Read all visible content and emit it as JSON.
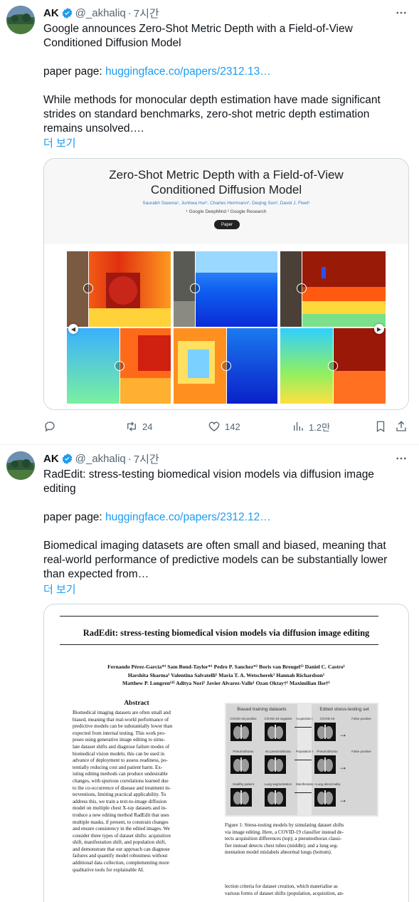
{
  "tweets": [
    {
      "author": {
        "name": "AK",
        "handle": "@_akhaliq",
        "time": "7시간"
      },
      "text_line1": "Google announces Zero-Shot Metric Depth with a Field-of-View",
      "text_line2": "Conditioned Diffusion Model",
      "paper_label": "paper page: ",
      "paper_link": "huggingface.co/papers/2312.13…",
      "body_line1": "While methods for monocular depth estimation have made significant",
      "body_line2": "strides on standard benchmarks, zero-shot metric depth estimation",
      "body_line3": "remains unsolved….",
      "show_more": "더 보기",
      "media": {
        "title_line1": "Zero-Shot Metric Depth with a Field-of-View",
        "title_line2": "Conditioned Diffusion Model",
        "authors": "Saurabh Saxena¹, Junhwa Hur², Charles Herrmann², Deqing Sun², David J. Fleet¹",
        "affiliations": "¹ Google DeepMind ² Google Research",
        "button": "Paper"
      },
      "stats": {
        "retweets": "24",
        "likes": "142",
        "views": "1.2만"
      }
    },
    {
      "author": {
        "name": "AK",
        "handle": "@_akhaliq",
        "time": "7시간"
      },
      "text_line1": "RadEdit: stress-testing biomedical vision models via diffusion image",
      "text_line2": "editing",
      "paper_label": "paper page: ",
      "paper_link": "huggingface.co/papers/2312.12…",
      "body_line1": "Biomedical imaging datasets are often small and biased, meaning that",
      "body_line2": "real-world performance of predictive models can be substantially lower",
      "body_line3": "than expected from…",
      "show_more": "더 보기",
      "media": {
        "title": "RadEdit: stress-testing biomedical vision models via diffusion image editing",
        "authors_line1": "Fernando Pérez-García*¹  Sam Bond-Taylor*¹  Pedro P. Sanchez*²  Boris van Breugel¹³  Daniel C. Castro¹",
        "authors_line2": "Harshita Sharma¹  Valentina Salvatelli¹  Maria T. A. Wetscherek¹  Hannah Richardson¹",
        "authors_line3": "Matthew P. Lungren¹⁴⁵  Aditya Nori¹  Javier Alvarez-Valle¹  Ozan Oktay†¹  Maximilian Ilse†¹",
        "abstract_heading": "Abstract",
        "abstract_lines": [
          "Biomedical imaging datasets are often small and",
          "biased, meaning that real-world performance of",
          "predictive models can be substantially lower than",
          "expected from internal testing.  This work pro-",
          "poses using generative image editing to simu-",
          "late dataset shifts and diagnose failure modes of",
          "biomedical vision models; this can be used in",
          "advance of deployment to assess readiness, po-",
          "tentially reducing cost and patient harm.  Ex-",
          "isting editing methods can produce undesirable",
          "changes, with spurious correlations learned due",
          "to the co-occurrence of disease and treatment in-",
          "terventions, limiting practical applicability.  To",
          "address this, we train a text-to-image diffusion",
          "model on multiple chest X-ray datasets and in-",
          "troduce a new editing method RadEdit that uses",
          "multiple masks, if present, to constrain changes",
          "and ensure consistency in the edited images. We",
          "consider three types of dataset shifts: acquisition",
          "shift, manifestation shift, and population shift,",
          "and demonstrate that our approach can diagnose",
          "failures and quantify model robustness without",
          "additional data collection, complementing more",
          "qualitative tools for explainable AI."
        ],
        "fig_left_title": "Biased training datasets",
        "fig_right_title": "Edited stress-testing set",
        "fig_row_labels": [
          [
            "COVID-19 positive",
            "COVID-19 negative",
            "Acquisition shift",
            "COVID-19",
            "False positive"
          ],
          [
            "Pneumothorax",
            "No pneumothorax",
            "Population shift",
            "Pneumothorax",
            "False positive"
          ],
          [
            "Healthy patient",
            "Lung segmentation",
            "Manifestation shift",
            "+Lung abnormality",
            ""
          ]
        ],
        "caption_lines": [
          "Figure 1: Stress-testing models by simulating dataset shifts",
          "via image editing.  Here, a COVID-19 classifier instead de-",
          "tects acquisition differences (top); a pneumothorax classi-",
          "fier instead detects chest tubes (middle); and a lung seg-",
          "mentation model mislabels abnormal lungs (bottom)."
        ],
        "body_lines": [
          "lection criteria for dataset creation, which materialise as",
          "various forms of dataset shifts (population, acquisition, an-"
        ]
      }
    }
  ],
  "colors": {
    "link": "#1d9bf0",
    "muted": "#536471",
    "verified": "#1d9bf0"
  }
}
